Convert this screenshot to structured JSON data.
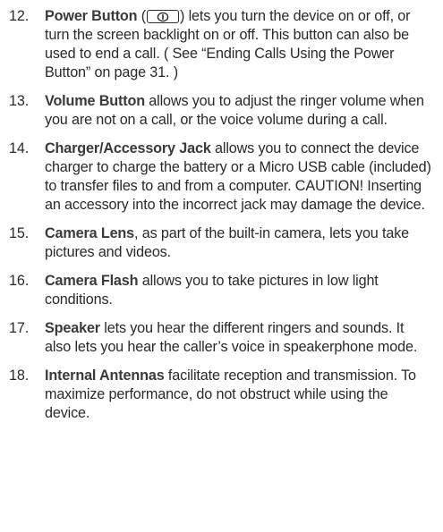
{
  "items": [
    {
      "number": "12.",
      "term": "Power Button",
      "icon": "power-button-icon",
      "before_icon": " (",
      "after_icon": ") lets you turn the device on or off, or turn the screen backlight on or off. This button can also be used to end a call. ( See “Ending Calls Using the Power Button” on page 31. )"
    },
    {
      "number": "13.",
      "term": "Volume Button",
      "text": " allows you to adjust the ringer volume when you are not on a call, or the voice volume during a call."
    },
    {
      "number": "14.",
      "term": "Charger/Accessory Jack",
      "text": " allows you to connect the device charger to charge the battery or a Micro USB cable (included) to transfer files to and from a computer. CAUTION! Inserting an accessory into the incorrect jack may damage the device."
    },
    {
      "number": "15.",
      "term": "Camera Lens",
      "text": ", as part of the built-in camera, lets you take pictures and videos."
    },
    {
      "number": "16.",
      "term": "Camera Flash",
      "text": " allows you to take pictures in low light conditions."
    },
    {
      "number": "17.",
      "term": "Speaker",
      "text": " lets you hear the different ringers and sounds. It also lets you hear the caller’s voice in speakerphone mode."
    },
    {
      "number": "18.",
      "term": "Internal Antennas",
      "text": " facilitate reception and transmission. To maximize performance, do not obstruct while using the device."
    }
  ]
}
